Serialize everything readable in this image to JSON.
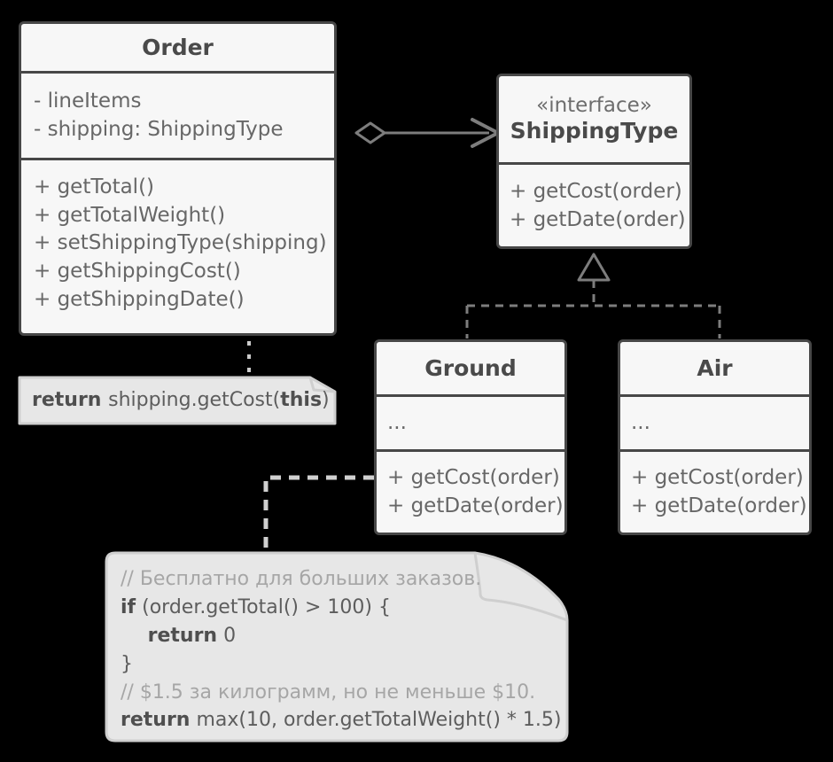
{
  "diagram": {
    "title": "Shipping strategy UML class diagram",
    "colors": {
      "background": "#000000",
      "class_fill": "#f7f7f7",
      "class_border": "#474747",
      "note_fill": "#e7e7e7",
      "note_border": "#cfcfcf",
      "text": "#676767",
      "title_text": "#4a4a4a",
      "comment_text": "#a6a6a6",
      "connector": "#7d7d7d",
      "note_connector": "#d0d0d0"
    }
  },
  "classes": {
    "order": {
      "name": "Order",
      "stereotype": "",
      "attributes": [
        "- lineItems",
        "- shipping: ShippingType"
      ],
      "methods": [
        "+ getTotal()",
        "+ getTotalWeight()",
        "+ setShippingType(shipping)",
        "+ getShippingCost()",
        "+ getShippingDate()"
      ]
    },
    "shipping_type": {
      "name": "ShippingType",
      "stereotype": "«interface»",
      "attributes": [],
      "methods": [
        "+ getCost(order)",
        "+ getDate(order)"
      ]
    },
    "ground": {
      "name": "Ground",
      "stereotype": "",
      "attributes": [
        "..."
      ],
      "methods": [
        "+ getCost(order)",
        "+ getDate(order)"
      ]
    },
    "air": {
      "name": "Air",
      "stereotype": "",
      "attributes": [
        "..."
      ],
      "methods": [
        "+ getCost(order)",
        "+ getDate(order)"
      ]
    }
  },
  "notes": {
    "order_note": {
      "lines": [
        [
          {
            "text": "return ",
            "style": "keyword"
          },
          {
            "text": "shipping.getCost(",
            "style": "plain"
          },
          {
            "text": "this",
            "style": "keyword"
          },
          {
            "text": ")",
            "style": "plain"
          }
        ]
      ]
    },
    "ground_note": {
      "lines": [
        [
          {
            "text": "// Бесплатно для больших заказов.",
            "style": "comment"
          }
        ],
        [
          {
            "text": "if",
            "style": "keyword"
          },
          {
            "text": " (order.getTotal() > 100) {",
            "style": "plain"
          }
        ],
        [
          {
            "text": "    return",
            "style": "keyword"
          },
          {
            "text": " 0",
            "style": "plain"
          }
        ],
        [
          {
            "text": "}",
            "style": "plain"
          }
        ],
        [
          {
            "text": "// $1.5 за килограмм, но не меньше $10.",
            "style": "comment"
          }
        ],
        [
          {
            "text": "return",
            "style": "keyword"
          },
          {
            "text": " max(10, order.getTotalWeight() * 1.5)",
            "style": "plain"
          }
        ]
      ]
    }
  },
  "relations": [
    {
      "name": "order-uses-shippingtype",
      "kind": "aggregation-with-arrow",
      "from": "Order",
      "to": "ShippingType"
    },
    {
      "name": "ground-implements-shippingtype",
      "kind": "realization",
      "from": "Ground",
      "to": "ShippingType"
    },
    {
      "name": "air-implements-shippingtype",
      "kind": "realization",
      "from": "Air",
      "to": "ShippingType"
    },
    {
      "name": "order-getshippingcost-note-link",
      "kind": "note-anchor",
      "from": "Order.getShippingCost()",
      "to": "order_note"
    },
    {
      "name": "ground-getcost-note-link",
      "kind": "note-anchor",
      "from": "Ground.getCost(order)",
      "to": "ground_note"
    }
  ]
}
